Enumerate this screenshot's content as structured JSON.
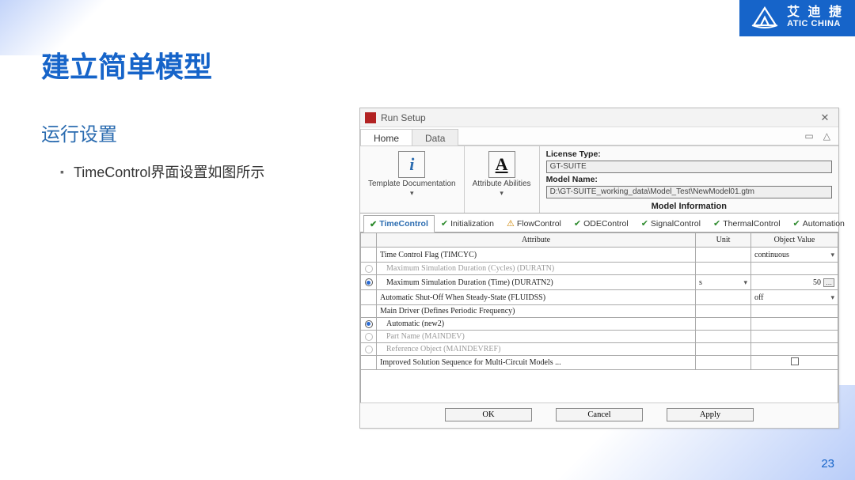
{
  "brand": {
    "cn": "艾 迪 捷",
    "en": "ATIC CHINA"
  },
  "slide": {
    "title": "建立简单模型",
    "subtitle": "运行设置",
    "bullet": "TimeControl界面设置如图所示",
    "page_num": "23"
  },
  "window": {
    "title": "Run Setup",
    "menu_tabs": {
      "home": "Home",
      "data": "Data"
    },
    "win_btns": {
      "restore": "▭",
      "min": "△"
    },
    "ribbon": {
      "group1_label": "Template Documentation",
      "group2_label": "Attribute Abilities",
      "license_label": "License Type:",
      "license_value": "GT-SUITE",
      "model_label": "Model Name:",
      "model_value": "D:\\GT-SUITE_working_data\\Model_Test\\NewModel01.gtm",
      "section": "Model Information"
    },
    "tabs": [
      {
        "icon": "check",
        "label": "TimeControl",
        "active": true
      },
      {
        "icon": "check",
        "label": "Initialization"
      },
      {
        "icon": "warn",
        "label": "FlowControl"
      },
      {
        "icon": "check",
        "label": "ODEControl"
      },
      {
        "icon": "check",
        "label": "SignalControl"
      },
      {
        "icon": "check",
        "label": "ThermalControl"
      },
      {
        "icon": "check",
        "label": "Automation"
      }
    ],
    "columns": {
      "attr": "Attribute",
      "unit": "Unit",
      "value": "Object Value"
    },
    "rows": [
      {
        "radio": "none",
        "attr": "Time Control Flag (TIMCYC)",
        "unit": "",
        "value_type": "select",
        "value": "continuous",
        "grey": false
      },
      {
        "radio": "off",
        "attr": "Maximum Simulation Duration (Cycles) (DURATN)",
        "unit": "",
        "value_type": "blank",
        "value": "",
        "grey": true
      },
      {
        "radio": "on",
        "attr": "Maximum Simulation Duration (Time) (DURATN2)",
        "unit": "s",
        "value_type": "spin",
        "value": "50",
        "grey": false
      },
      {
        "radio": "none",
        "attr": "Automatic Shut-Off When Steady-State (FLUIDSS)",
        "unit": "",
        "value_type": "select",
        "value": "off",
        "grey": false
      },
      {
        "radio": "none",
        "attr": "Main Driver (Defines Periodic Frequency)",
        "unit": "",
        "value_type": "blank",
        "value": "",
        "grey": false
      },
      {
        "radio": "on",
        "attr": "Automatic (new2)",
        "unit": "",
        "value_type": "blank",
        "value": "",
        "grey": false
      },
      {
        "radio": "off",
        "attr": "Part Name (MAINDEV)",
        "unit": "",
        "value_type": "blank",
        "value": "",
        "grey": true
      },
      {
        "radio": "off",
        "attr": "Reference Object (MAINDEVREF)",
        "unit": "",
        "value_type": "blank",
        "value": "",
        "grey": true
      },
      {
        "radio": "none",
        "attr": "Improved Solution Sequence for Multi-Circuit Models ...",
        "unit": "",
        "value_type": "checkbox",
        "value": "",
        "grey": false
      }
    ],
    "buttons": {
      "ok": "OK",
      "cancel": "Cancel",
      "apply": "Apply"
    }
  }
}
